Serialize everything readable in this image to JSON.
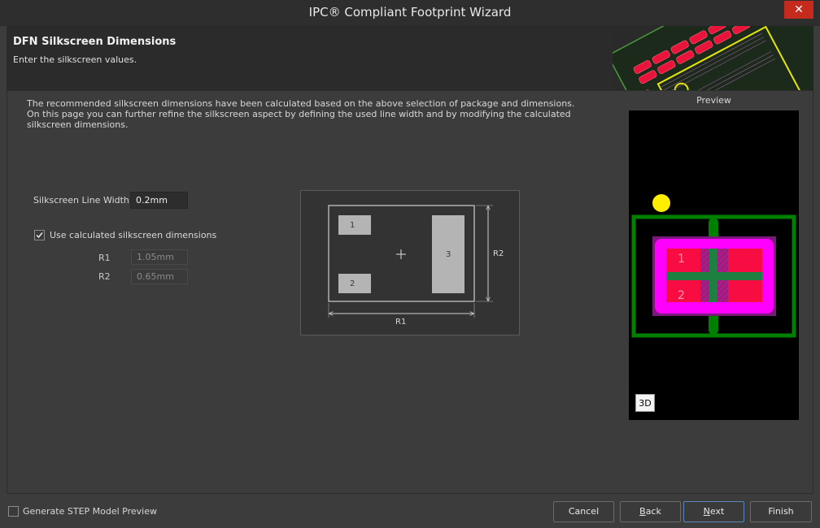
{
  "window": {
    "title": "IPC® Compliant Footprint Wizard",
    "close_glyph": "✕"
  },
  "header": {
    "title": "DFN Silkscreen Dimensions",
    "subtitle": "Enter the silkscreen values."
  },
  "description": [
    "The recommended silkscreen dimensions have been calculated based on the above selection of package and dimensions.",
    "On this page you can further refine the silkscreen aspect by defining the used line width and by modifying the calculated",
    "silkscreen dimensions."
  ],
  "form": {
    "line_width_label": "Silkscreen Line Width",
    "line_width_value": "0.2mm",
    "use_calculated_label": "Use calculated silkscreen dimensions",
    "use_calculated_checked": true,
    "r1_label": "R1",
    "r1_value": "1.05mm",
    "r2_label": "R2",
    "r2_value": "0.65mm"
  },
  "diagram": {
    "pad1": "1",
    "pad2": "2",
    "pad3": "3",
    "r1_label": "R1",
    "r2_label": "R2"
  },
  "preview": {
    "label": "Preview",
    "pad1": "1",
    "pad2": "2",
    "button_3d": "3D"
  },
  "footer": {
    "step_preview_label": "Generate STEP Model Preview",
    "step_preview_checked": false,
    "cancel": "Cancel",
    "back_prefix": "",
    "back_mnemonic": "B",
    "back_rest": "ack",
    "next_mnemonic": "N",
    "next_rest": "ext",
    "finish": "Finish"
  },
  "colors": {
    "accent": "#5d86b8",
    "close": "#c42b1c",
    "silk_green": "#008000",
    "pad_magenta": "#ff00ff",
    "pad_red": "#ff0a3c",
    "pin1_dot": "#ffee00"
  }
}
